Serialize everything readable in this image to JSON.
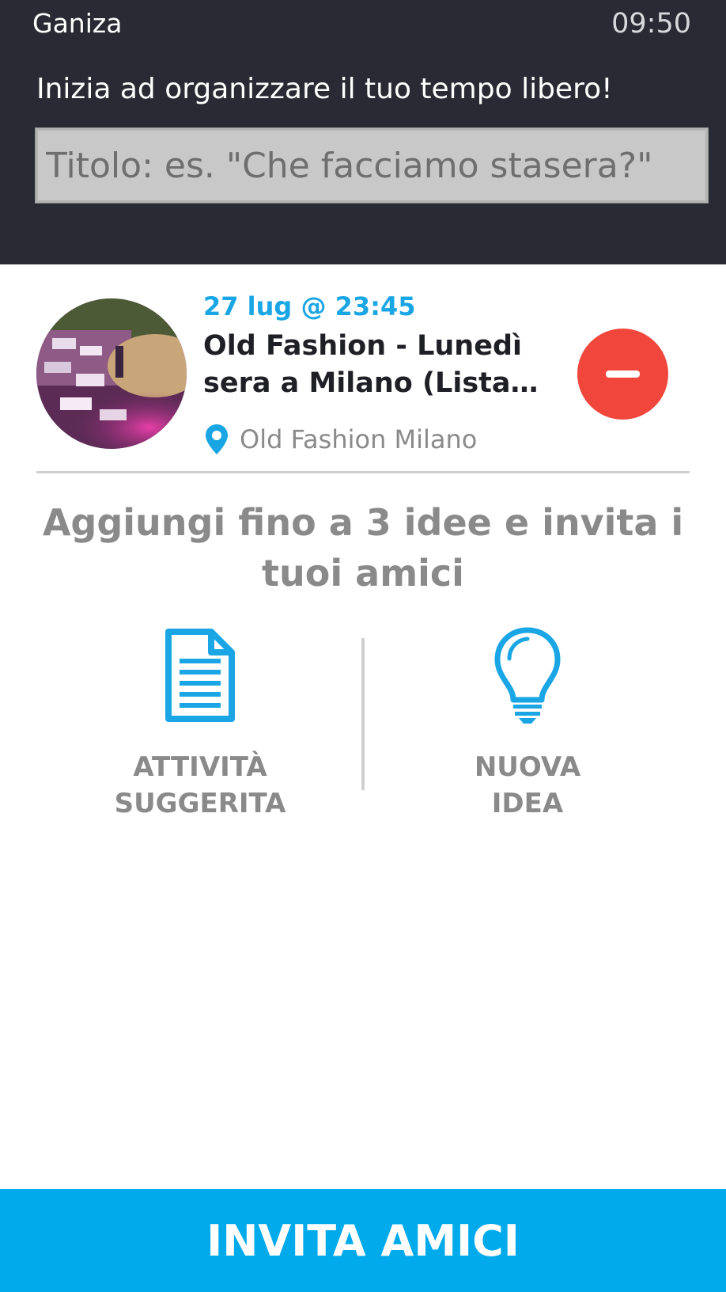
{
  "app": {
    "name": "Ganiza",
    "time": "09:50"
  },
  "header": {
    "subtitle": "Inizia ad organizzare il tuo tempo libero!",
    "title_placeholder": "Titolo: es. \"Che facciamo stasera?\""
  },
  "event": {
    "date": "27 lug @ 23:45",
    "title": "Old Fashion - Lunedì sera a Milano (Lista…",
    "location": "Old Fashion Milano"
  },
  "prompt": "Aggiungi fino a 3 idee e invita i tuoi amici",
  "options": [
    {
      "label": "ATTIVITÀ\nSUGGERITA",
      "icon": "document-icon"
    },
    {
      "label": "NUOVA\nIDEA",
      "icon": "lightbulb-icon"
    }
  ],
  "invite_button": "INVITA AMICI",
  "colors": {
    "header_bg": "#2a2a34",
    "accent_blue": "#00aaeb",
    "date_blue": "#1aa6e4",
    "remove_red": "#f0463b"
  }
}
